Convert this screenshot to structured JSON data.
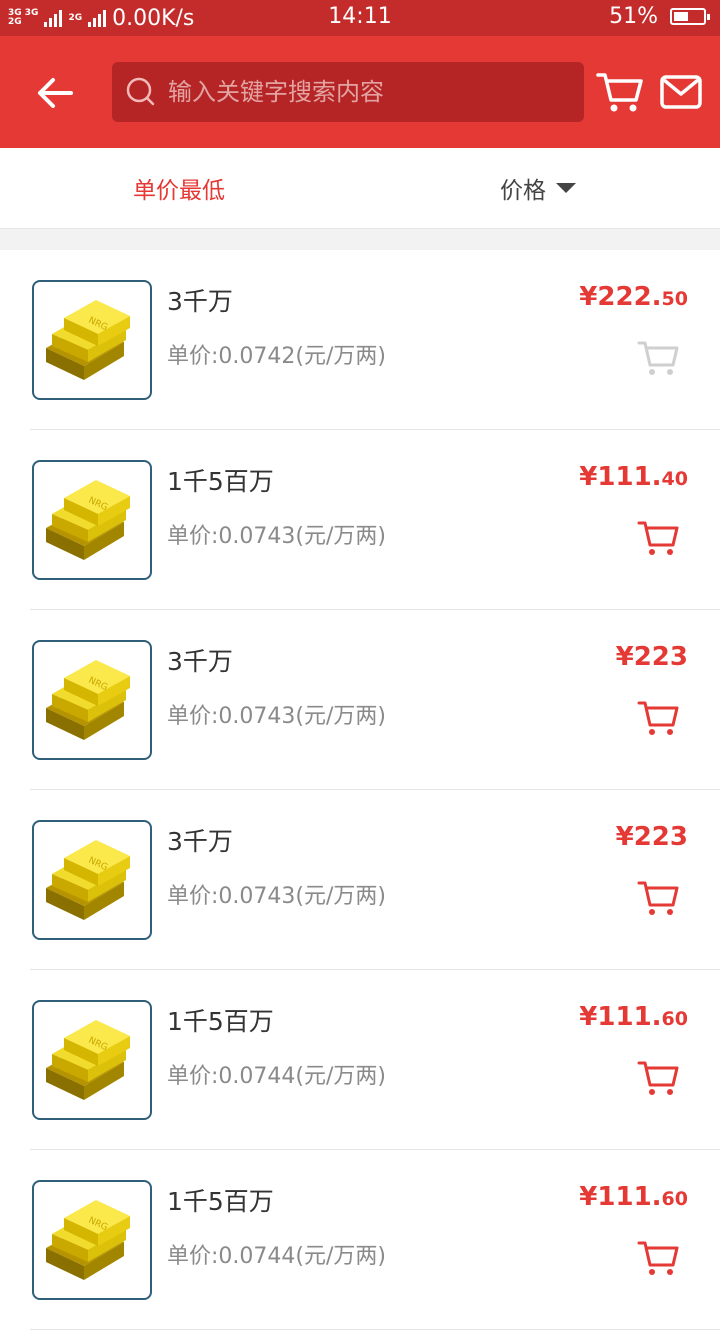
{
  "status_bar": {
    "net_top": "3G 3G",
    "net_bottom": "2G",
    "net_mid": "2G",
    "speed": "0.00K/s",
    "time": "14:11",
    "battery": "51%",
    "battery_level": 0.51
  },
  "header": {
    "search_placeholder": "输入关键字搜索内容",
    "accent_color": "#e53935"
  },
  "sort": {
    "active_label": "单价最低",
    "price_label": "价格"
  },
  "items": [
    {
      "title": "3千万",
      "unit_price": "单价:0.0742(元/万两)",
      "price_main": "¥222.",
      "price_dec": "50",
      "cart_enabled": false
    },
    {
      "title": "1千5百万",
      "unit_price": "单价:0.0743(元/万两)",
      "price_main": "¥111.",
      "price_dec": "40",
      "cart_enabled": true
    },
    {
      "title": "3千万",
      "unit_price": "单价:0.0743(元/万两)",
      "price_main": "¥223",
      "price_dec": "",
      "cart_enabled": true
    },
    {
      "title": "3千万",
      "unit_price": "单价:0.0743(元/万两)",
      "price_main": "¥223",
      "price_dec": "",
      "cart_enabled": true
    },
    {
      "title": "1千5百万",
      "unit_price": "单价:0.0744(元/万两)",
      "price_main": "¥111.",
      "price_dec": "60",
      "cart_enabled": true
    },
    {
      "title": "1千5百万",
      "unit_price": "单价:0.0744(元/万两)",
      "price_main": "¥111.",
      "price_dec": "60",
      "cart_enabled": true
    }
  ]
}
